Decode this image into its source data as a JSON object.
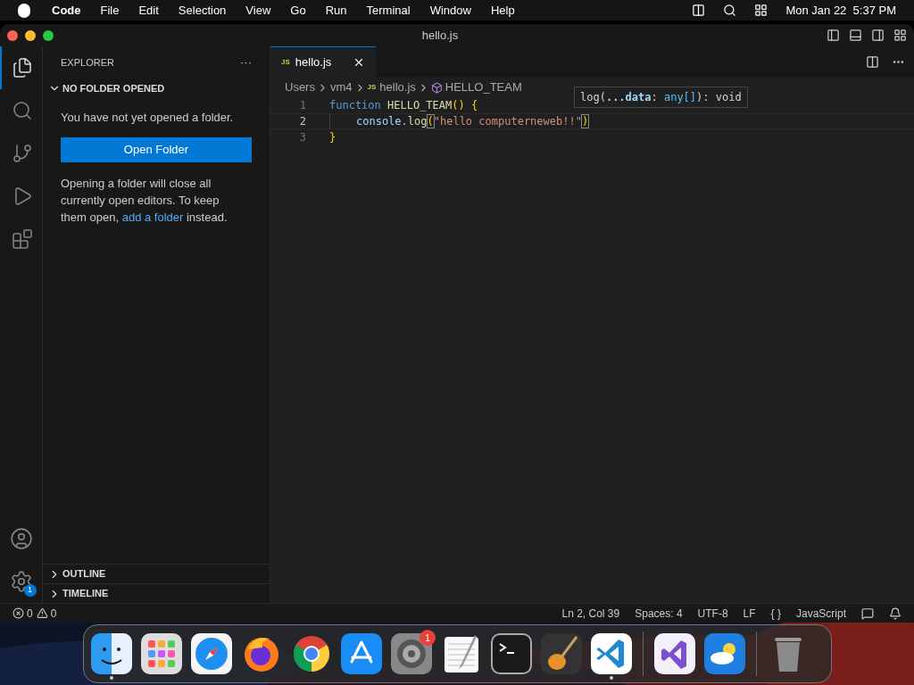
{
  "menu_bar": {
    "app": "Code",
    "items": [
      "File",
      "Edit",
      "Selection",
      "View",
      "Go",
      "Run",
      "Terminal",
      "Window",
      "Help"
    ],
    "clock": "Mon Jan 22  5:37 PM"
  },
  "window": {
    "title": "hello.js"
  },
  "activity_bar": [
    {
      "kind": "files",
      "selected": true
    },
    {
      "kind": "search",
      "selected": false
    },
    {
      "kind": "source-control",
      "selected": false
    },
    {
      "kind": "run",
      "selected": false
    },
    {
      "kind": "extensions",
      "selected": false
    }
  ],
  "activity_bottom": {
    "settings_badge": "1"
  },
  "sidebar": {
    "title": "EXPLORER",
    "more": "···",
    "section": {
      "title": "NO FOLDER OPENED",
      "expanded": true
    },
    "message": "You have not yet opened a folder.",
    "button": "Open Folder",
    "note": "Opening a folder will close all currently open editors. To keep them open,",
    "note_link": "add a folder",
    "note_end": "instead.",
    "panels": [
      {
        "title": "OUTLINE",
        "expanded": false
      },
      {
        "title": "TIMELINE",
        "expanded": false
      }
    ]
  },
  "tabs": [
    {
      "badge": "JS",
      "label": "hello.js",
      "selected": true
    }
  ],
  "breadcrumbs": [
    {
      "kind": "folder",
      "label": "Users"
    },
    {
      "kind": "folder",
      "label": "vm4"
    },
    {
      "kind": "file",
      "badge": "JS",
      "label": "hello.js"
    },
    {
      "kind": "symbol",
      "label": "HELLO_TEAM"
    }
  ],
  "code": [
    {
      "number": "1",
      "current": false,
      "indent": false,
      "tokens": [
        {
          "kind": "keyword",
          "text": "function"
        },
        {
          "kind": "function",
          "text": "HELLO_TEAM",
          "space_before": true
        },
        {
          "kind": "bracket",
          "text": "()"
        },
        {
          "kind": "bracket",
          "text": "{",
          "space_before": true
        }
      ]
    },
    {
      "number": "2",
      "current": true,
      "indent": true,
      "tokens": [
        {
          "kind": "variable",
          "text": "console"
        },
        {
          "kind": "plain",
          "text": "."
        },
        {
          "kind": "function",
          "text": "log"
        },
        {
          "kind": "match",
          "text": "("
        },
        {
          "kind": "string",
          "text": "\"hello computerneweb!!\""
        },
        {
          "kind": "match",
          "text": ")"
        }
      ]
    },
    {
      "number": "3",
      "current": false,
      "indent": false,
      "tokens": [
        {
          "kind": "bracket",
          "text": "}"
        }
      ]
    }
  ],
  "hover": [
    {
      "kind": "plain",
      "text": "log("
    },
    {
      "kind": "param",
      "text": "...data"
    },
    {
      "kind": "plain",
      "text": ": "
    },
    {
      "kind": "type",
      "text": "any[]"
    },
    {
      "kind": "plain",
      "text": "): void"
    }
  ],
  "status_bar": {
    "errors": "0",
    "warnings": "0",
    "right": [
      "Ln 2, Col 39",
      "Spaces: 4",
      "UTF-8",
      "LF",
      "{ }",
      "JavaScript"
    ]
  },
  "dock": [
    {
      "kind": "finder",
      "running": true
    },
    {
      "kind": "launchpad",
      "running": false
    },
    {
      "kind": "safari",
      "running": false
    },
    {
      "kind": "firefox",
      "running": false
    },
    {
      "kind": "chrome",
      "running": false
    },
    {
      "kind": "appstore",
      "running": false
    },
    {
      "kind": "settings",
      "running": false,
      "badge": "1"
    },
    {
      "kind": "textedit",
      "running": false
    },
    {
      "kind": "terminal",
      "running": false
    },
    {
      "kind": "garageband",
      "running": false
    },
    {
      "kind": "vscode",
      "running": true
    },
    {
      "kind": "separator"
    },
    {
      "kind": "visualstudio",
      "running": false
    },
    {
      "kind": "weather",
      "running": false
    },
    {
      "kind": "separator"
    },
    {
      "kind": "trash",
      "running": false
    }
  ]
}
